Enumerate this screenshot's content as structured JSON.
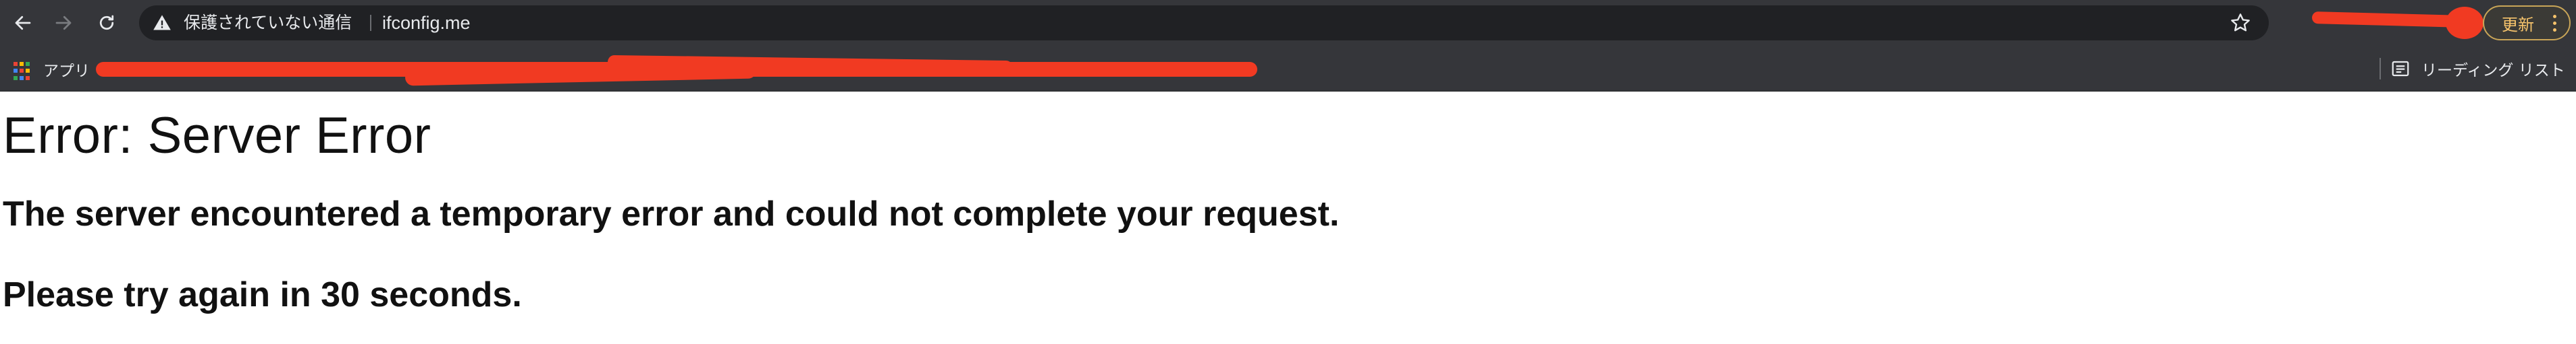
{
  "browser": {
    "nav": {
      "back_icon": "arrow-left-icon",
      "forward_icon": "arrow-right-icon",
      "reload_icon": "reload-icon"
    },
    "omnibox": {
      "security_icon": "warning-triangle-icon",
      "security_text": "保護されていない通信",
      "url": "ifconfig.me",
      "bookmark_icon": "star-icon"
    },
    "update_button": {
      "label": "更新",
      "menu_icon": "kebab-menu-icon",
      "accent_color": "#f5c26b"
    },
    "bookmarks_bar": {
      "apps_label": "アプリ",
      "reading_list_label": "リーディング リスト"
    },
    "colors": {
      "chrome_bg": "#35363a",
      "omnibox_bg": "#202124",
      "redaction": "#f13a22"
    }
  },
  "page": {
    "title": "Error: Server Error",
    "message": "The server encountered a temporary error and could not complete your request.",
    "retry_message": "Please try again in 30 seconds."
  }
}
